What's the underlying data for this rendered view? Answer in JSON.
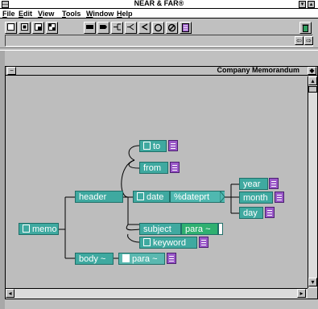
{
  "app": {
    "title": "NEAR & FAR®"
  },
  "menu": [
    "File",
    "Edit",
    "View",
    "Tools",
    "Window",
    "Help"
  ],
  "menu_underline": [
    "F",
    "E",
    "V",
    "T",
    "W",
    "H"
  ],
  "toolbar": {
    "icons": [
      "new-doc-icon",
      "open-doc-icon",
      "save-doc-icon",
      "print-doc-icon",
      "element-icon",
      "attribute-icon",
      "connector-icon",
      "branch-icon",
      "choice-icon",
      "circle-icon",
      "no-icon",
      "list-icon",
      "trash-icon"
    ],
    "nav_left": "⇦",
    "nav_right": "⇨"
  },
  "document": {
    "title": "Company Memorandum"
  },
  "tree": {
    "memo": "memo",
    "header": "header",
    "to": "to",
    "from": "from",
    "date": "date",
    "dateprt": "%dateprt",
    "year": "year",
    "month": "month",
    "day": "day",
    "subject": "subject",
    "subject_para": "para ~",
    "keyword": "keyword",
    "body": "body ~",
    "body_para": "para ~"
  },
  "colors": {
    "node": "#3fa9a0",
    "badge": "#9a58c8",
    "para_green": "#2fb070"
  }
}
